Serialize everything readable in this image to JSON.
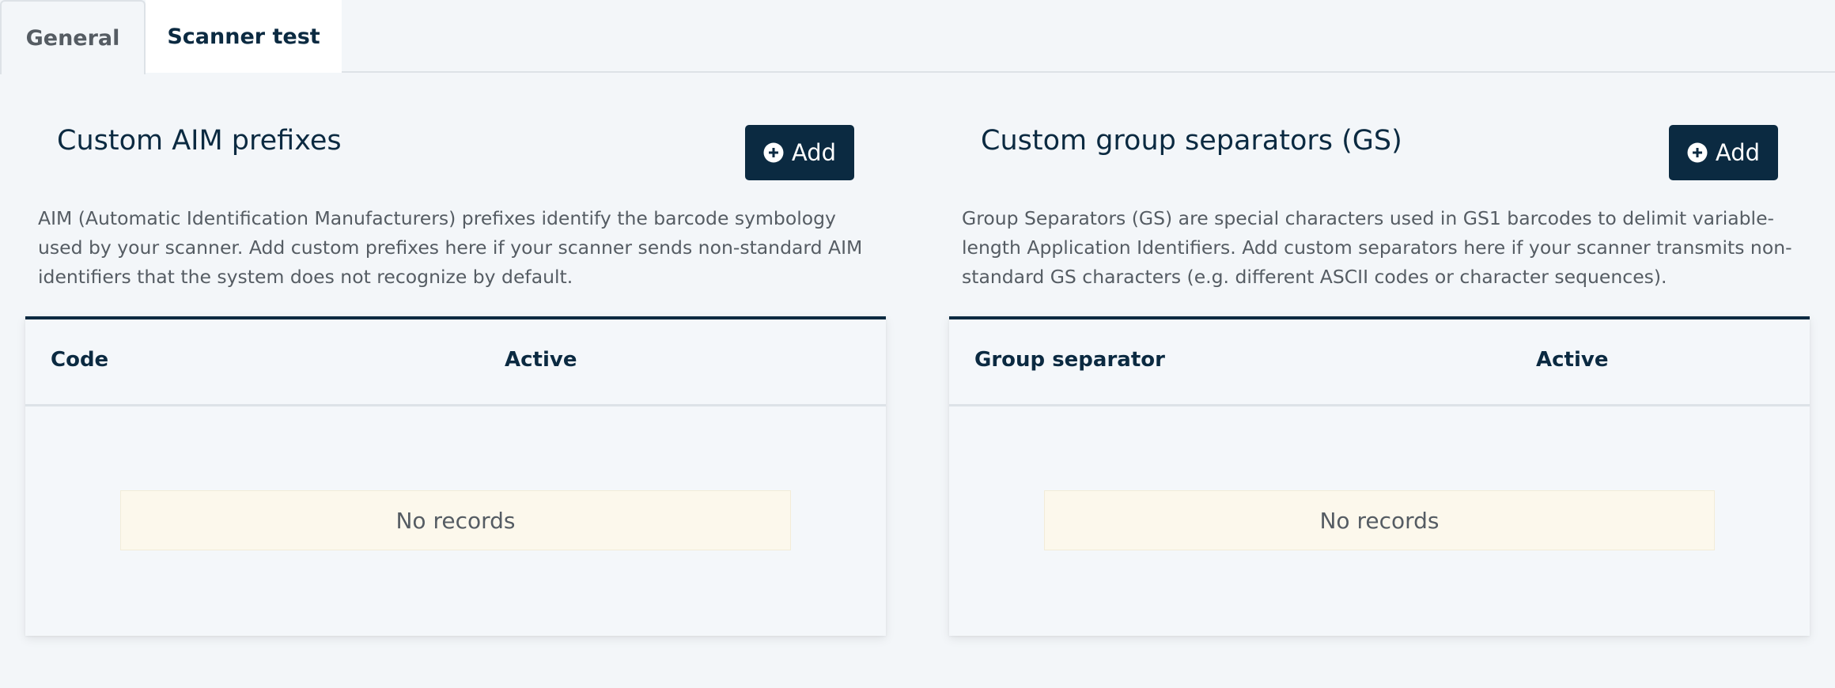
{
  "tabs": {
    "general": "General",
    "scanner_test": "Scanner test"
  },
  "left_panel": {
    "title": "Custom AIM prefixes",
    "add_label": "Add",
    "description": "AIM (Automatic Identification Manufacturers) prefixes identify the barcode symbology used by your scanner. Add custom prefixes here if your scanner sends non-standard AIM identifiers that the system does not recognize by default.",
    "columns": [
      "Code",
      "Active"
    ],
    "empty_text": "No records"
  },
  "right_panel": {
    "title": "Custom group separators (GS)",
    "add_label": "Add",
    "description": "Group Separators (GS) are special characters used in GS1 barcodes to delimit variable-length Application Identifiers. Add custom separators here if your scanner transmits non-standard GS characters (e.g. different ASCII codes or character sequences).",
    "columns": [
      "Group separator",
      "Active"
    ],
    "empty_text": "No records"
  },
  "colors": {
    "primary": "#0b2a41",
    "background": "#f3f6f9",
    "empty_state": "#fcf8ec"
  },
  "icons": {
    "add": "plus-circle-icon"
  }
}
